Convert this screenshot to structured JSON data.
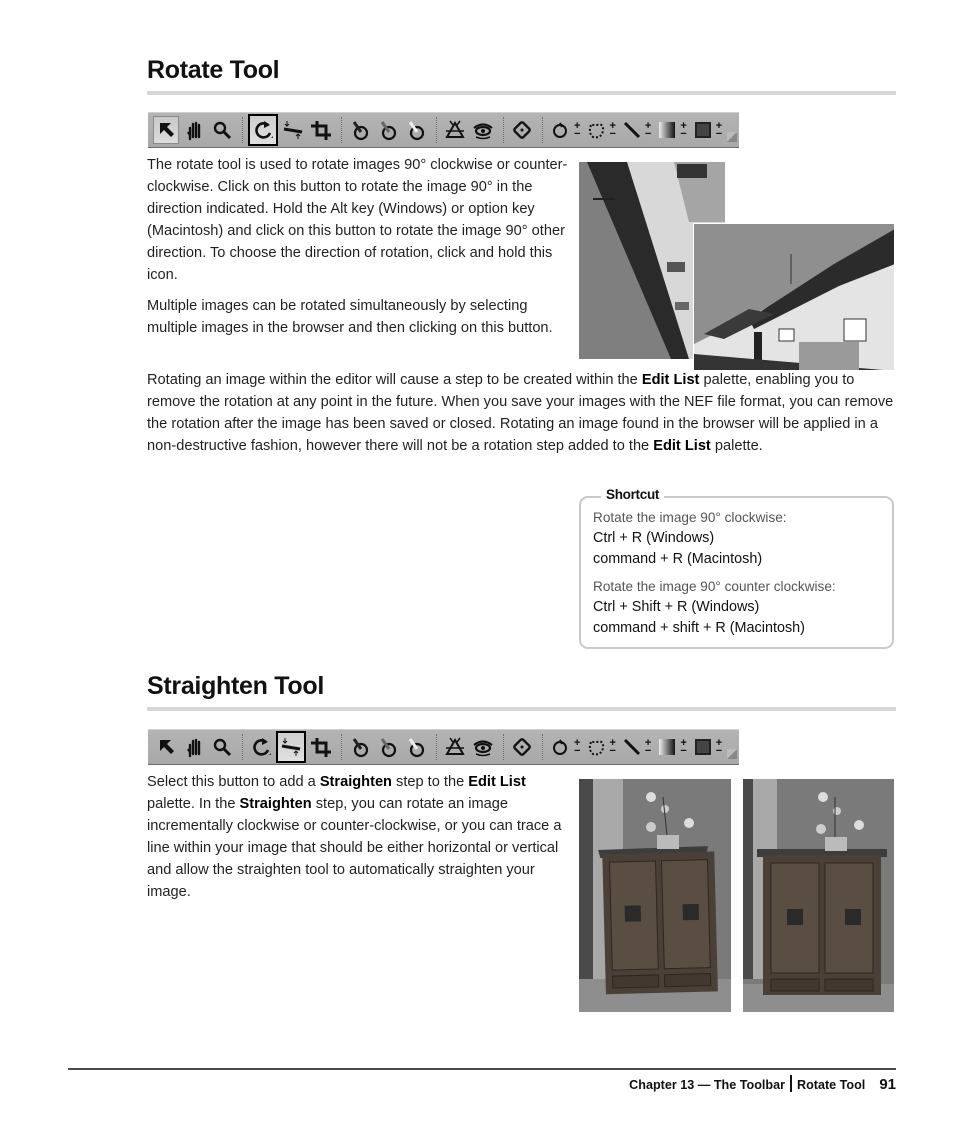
{
  "rotate_section": {
    "title": "Rotate Tool",
    "toolbar_active": "rotate",
    "paragraphs": [
      [
        "The rotate tool is used to rotate images 90° clockwise or counter-clockwise. Click on this button to rotate the image 90° in the direction indicated. Hold the Alt key (Windows) or option key (Macintosh) and click on this button to rotate the image 90° other direction. To choose the direction of rotation, click and hold this icon."
      ],
      [
        "Multiple images can be rotated simultaneously by selecting multiple images in the browser and then clicking on this button."
      ]
    ],
    "p3": {
      "t1": "Rotating an image within the editor will cause a step to be created within the ",
      "b1": "Edit List",
      "t2": " palette, enabling you to remove the rotation at any point in the future. When you save your images with the NEF file format, you can remove the rotation after the image has been saved or closed. Rotating an image found in the browser will be applied in a non-destructive fashion, however there will not be a rotation step added to the ",
      "b2": "Edit List",
      "t3": " palette."
    },
    "photo_description": "Rotated and upright photos of a village street with cottages"
  },
  "shortcut": {
    "title": "Shortcut",
    "groups": [
      {
        "label": "Rotate the image 90° clockwise:",
        "keys": [
          "Ctrl + R (Windows)",
          "command + R (Macintosh)"
        ]
      },
      {
        "label": "Rotate the image 90° counter clockwise:",
        "keys": [
          "Ctrl + Shift + R (Windows)",
          "command + shift + R (Macintosh)"
        ]
      }
    ]
  },
  "straighten_section": {
    "title": "Straighten Tool",
    "toolbar_active": "straighten",
    "p1": {
      "t1": "Select this button to add a ",
      "b1": "Straighten",
      "t2": " step to the ",
      "b2": "Edit List",
      "t3": " palette. In the ",
      "b3": "Straighten",
      "t4": " step, you can rotate an image incrementally clockwise or counter-clockwise, or you can trace a line within your image that should be either horizontal or vertical and allow the straighten tool to automatically straighten your image."
    },
    "photo_description": "Before and after photos of a wooden cabinet with an orchid"
  },
  "toolbar_tools": [
    "select",
    "hand",
    "zoom",
    "|",
    "rotate",
    "straighten",
    "crop",
    "|",
    "black-point-picker",
    "neutral-point-picker",
    "white-point-picker",
    "|",
    "auto-retouch-brush",
    "red-eye",
    "|",
    "color-control-point",
    "|",
    "lasso-selection",
    "marquee-selection",
    "brush-selection",
    "gradient-selection",
    "fill-remove",
    "corner"
  ],
  "footer": {
    "chapter": "Chapter 13 — The Toolbar",
    "section": "Rotate Tool",
    "page_number": "91"
  }
}
